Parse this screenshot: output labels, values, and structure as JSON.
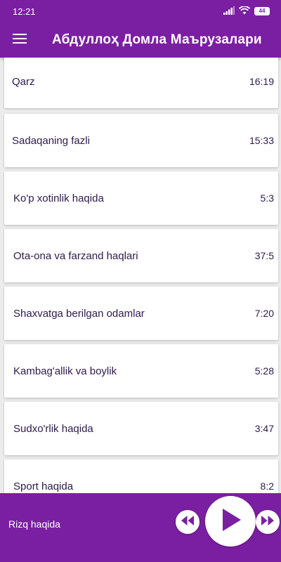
{
  "status_bar": {
    "time": "12:21",
    "battery": "44",
    "icons": [
      "signal-icon",
      "wifi-icon",
      "battery-icon"
    ]
  },
  "app_bar": {
    "title": "Абдуллоҳ Домла Маърузалари",
    "menu_icon": "hamburger-menu-icon"
  },
  "lectures": [
    {
      "title": "Qarz",
      "duration": "16:19"
    },
    {
      "title": "Sadaqaning fazli",
      "duration": "15:33"
    },
    {
      "title": " Ko'p xotinlik haqida",
      "duration": "5:3"
    },
    {
      "title": "Ota-ona va farzand haqlari",
      "duration": "37:5"
    },
    {
      "title": "Shaxvatga berilgan odamlar",
      "duration": "7:20"
    },
    {
      "title": "Kambag'allik va boylik",
      "duration": "5:28"
    },
    {
      "title": "Sudxo'rlik haqida",
      "duration": "3:47"
    },
    {
      "title": " Sport haqida",
      "duration": "8:2"
    }
  ],
  "player": {
    "current_track": "Rizq haqida",
    "icons": [
      "rewind-icon",
      "play-icon",
      "fast-forward-icon"
    ]
  },
  "colors": {
    "primary": "#7b1fa2",
    "list_text": "#2d1a4a",
    "background": "#ececec"
  }
}
